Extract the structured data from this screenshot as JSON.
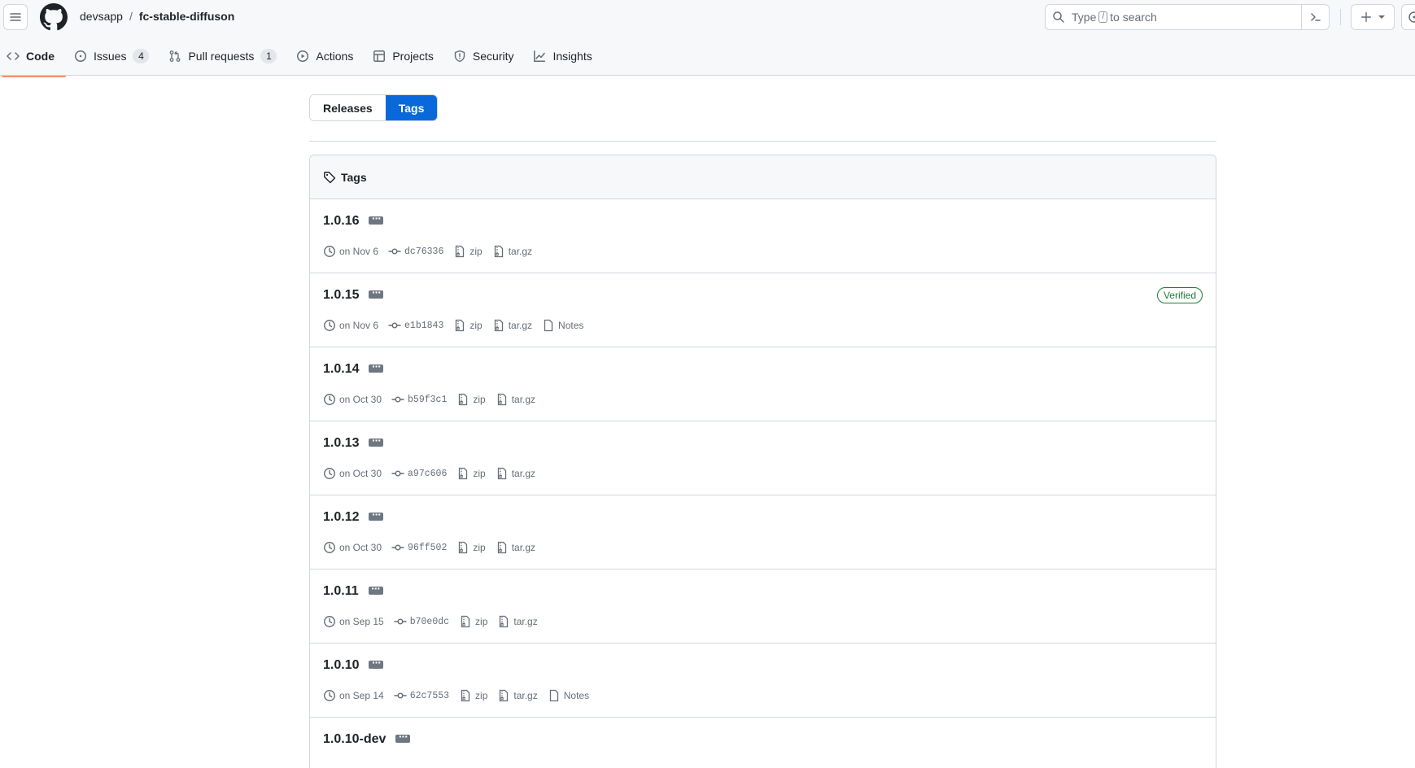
{
  "header": {
    "owner": "devsapp",
    "separator": "/",
    "repo": "fc-stable-diffuson",
    "search": {
      "prefix": "Type",
      "key": "/",
      "suffix": "to search"
    }
  },
  "nav": {
    "tabs": [
      {
        "label": "Code",
        "icon": "code-icon"
      },
      {
        "label": "Issues",
        "icon": "issue-icon",
        "count": "4"
      },
      {
        "label": "Pull requests",
        "icon": "pull-request-icon",
        "count": "1"
      },
      {
        "label": "Actions",
        "icon": "play-icon"
      },
      {
        "label": "Projects",
        "icon": "table-icon"
      },
      {
        "label": "Security",
        "icon": "shield-icon"
      },
      {
        "label": "Insights",
        "icon": "graph-icon"
      }
    ]
  },
  "segmented": {
    "releases": "Releases",
    "tags": "Tags"
  },
  "tags_box": {
    "title": "Tags",
    "rows": [
      {
        "name": "1.0.16",
        "date": "on Nov 6",
        "sha": "dc76336",
        "zip": "zip",
        "targz": "tar.gz"
      },
      {
        "name": "1.0.15",
        "date": "on Nov 6",
        "sha": "e1b1843",
        "zip": "zip",
        "targz": "tar.gz",
        "notes": "Notes",
        "verified": "Verified"
      },
      {
        "name": "1.0.14",
        "date": "on Oct 30",
        "sha": "b59f3c1",
        "zip": "zip",
        "targz": "tar.gz"
      },
      {
        "name": "1.0.13",
        "date": "on Oct 30",
        "sha": "a97c606",
        "zip": "zip",
        "targz": "tar.gz"
      },
      {
        "name": "1.0.12",
        "date": "on Oct 30",
        "sha": "96ff502",
        "zip": "zip",
        "targz": "tar.gz"
      },
      {
        "name": "1.0.11",
        "date": "on Sep 15",
        "sha": "b70e0dc",
        "zip": "zip",
        "targz": "tar.gz"
      },
      {
        "name": "1.0.10",
        "date": "on Sep 14",
        "sha": "62c7553",
        "zip": "zip",
        "targz": "tar.gz",
        "notes": "Notes"
      },
      {
        "name": "1.0.10-dev"
      }
    ]
  },
  "colors": {
    "accent": "#0969da",
    "active_tab_underline": "#fd8c73",
    "verified": "#1a7f37",
    "border": "#d0d7de"
  }
}
